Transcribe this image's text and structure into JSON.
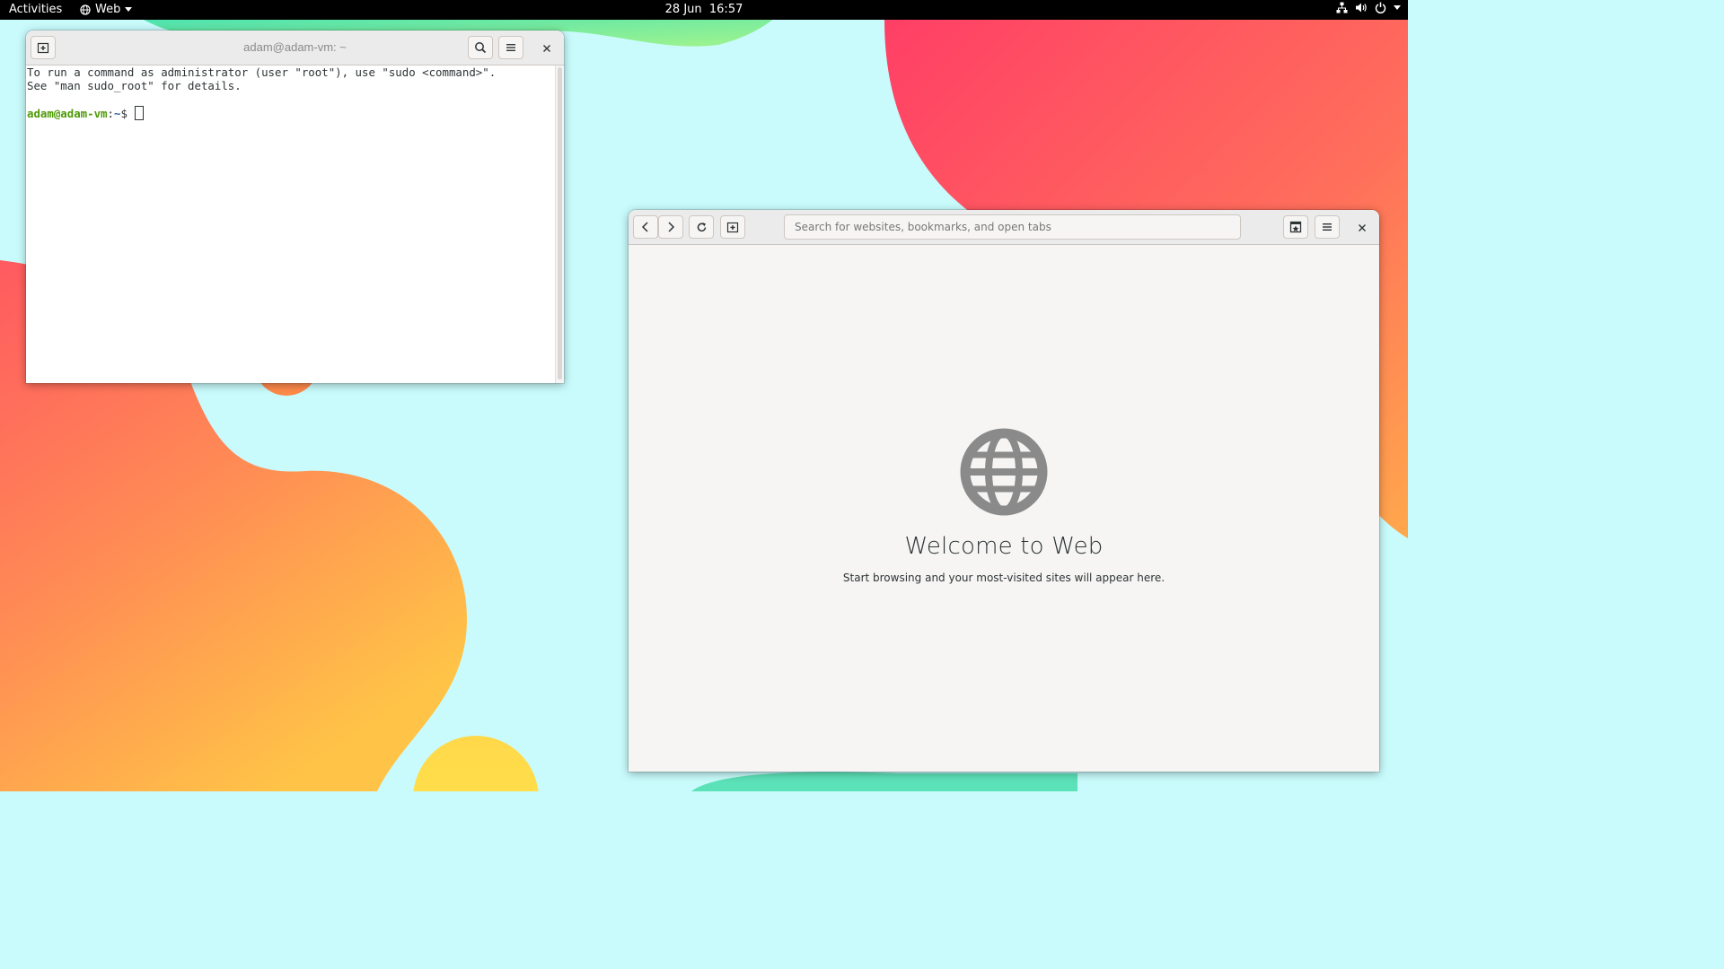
{
  "topbar": {
    "activities": "Activities",
    "app_menu": "Web",
    "clock": "28 Jun  16:57",
    "icons": [
      "network-icon",
      "volume-icon",
      "power-icon",
      "chevron-down-icon"
    ]
  },
  "terminal": {
    "title": "adam@adam-vm: ~",
    "lines": [
      "To run a command as administrator (user \"root\"), use \"sudo <command>\".",
      "See \"man sudo_root\" for details."
    ],
    "prompt_user": "adam@adam-vm",
    "prompt_sep": ":",
    "prompt_path": "~",
    "prompt_symbol": "$ "
  },
  "browser": {
    "search_placeholder": "Search for websites, bookmarks, and open tabs",
    "welcome_title": "Welcome to Web",
    "welcome_subtitle": "Start browsing and your most-visited sites will appear here."
  },
  "colors": {
    "topbar_bg": "#000000",
    "desktop_bg": "#c9fbfc",
    "prompt_user": "#4e9a06",
    "prompt_path": "#3465a4"
  }
}
